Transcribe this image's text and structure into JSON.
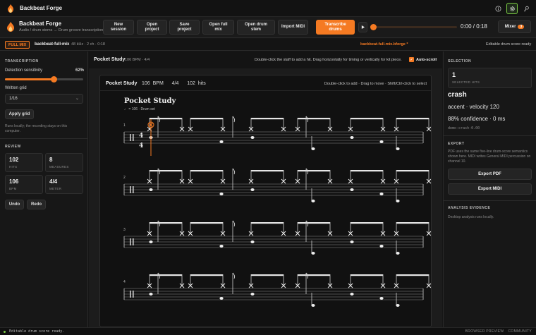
{
  "window": {
    "title": "Backbeat Forge"
  },
  "app": {
    "name": "Backbeat Forge",
    "subtitle": "Audio / drum stems → Drum groove transcription"
  },
  "toolbar": {
    "new_session": "New session",
    "open_project": "Open project",
    "save_project": "Save project",
    "open_full_mix": "Open full mix",
    "open_drum_stem": "Open drum stem",
    "import_midi": "Import MIDI",
    "transcribe_drums": "Transcribe drums",
    "time": "0:00 / 0:18",
    "playback_progress": 0.0,
    "mixer_label": "Mixer",
    "mixer_count": "3"
  },
  "track": {
    "source_badge": "FULL MIX",
    "name": "backbeat-full-mix",
    "meta": "48 kHz · 2 ch · 0:18",
    "file": "backbeat-full-mix.bforge *",
    "state": "Editable drum score ready"
  },
  "transcription": {
    "section_title": "TRANSCRIPTION",
    "sensitivity_label": "Detection sensitivity",
    "sensitivity_value": "62%",
    "sensitivity_fraction": 0.62,
    "grid_label": "Written grid",
    "grid_value": "1/16",
    "apply_grid": "Apply grid",
    "hint": "Runs locally; the recording stays on this computer."
  },
  "review": {
    "section_title": "REVIEW",
    "stats": [
      {
        "value": "102",
        "label": "HITS"
      },
      {
        "value": "8",
        "label": "MEASURES"
      },
      {
        "value": "106",
        "label": "BPM"
      },
      {
        "value": "4/4",
        "label": "METER"
      }
    ],
    "undo": "Undo",
    "redo": "Redo"
  },
  "score": {
    "title": "Pocket Study",
    "meta": "106 BPM · 4/4",
    "hint": "Double-click the staff to add a hit. Drag horizontally for timing or vertically for kit piece.",
    "autoscroll_label": "Auto-scroll",
    "autoscroll_checked": true,
    "card_title": "Pocket Study",
    "card_bpm": "106 BPM",
    "card_meter": "4/4",
    "card_hits": "102 hits",
    "card_hint": "Double-click to add · Drag to move · Shift/Ctrl-click to select",
    "sheet_title": "Pocket Study",
    "sheet_sub": "♩ = 106 · Drum set",
    "systems": [
      "1",
      "2",
      "3",
      "4"
    ],
    "time_signature": [
      "4",
      "4"
    ]
  },
  "selection": {
    "section_title": "SELECTION",
    "count": "1",
    "count_label": "SELECTED HITS",
    "instrument": "crash",
    "accent_velocity": "accent · velocity 120",
    "confidence": "88% confidence · 0 ms",
    "id": "demo-crash-0.00"
  },
  "export": {
    "section_title": "EXPORT",
    "note": "PDF uses the same five-line drum-score semantics shown here. MIDI writes General MIDI percussion on channel 10.",
    "pdf": "Export PDF",
    "midi": "Export MIDI"
  },
  "analysis": {
    "section_title": "ANALYSIS EVIDENCE",
    "note": "Desktop analysis runs locally."
  },
  "status": {
    "text": "Editable drum score ready.",
    "preview": "BROWSER PREVIEW",
    "community": "COMMUNITY"
  },
  "colors": {
    "accent": "#f57a22",
    "active_green": "#7ac943",
    "background": "#161616"
  }
}
